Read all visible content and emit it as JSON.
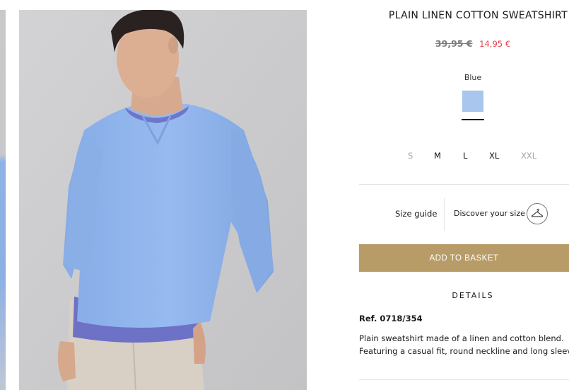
{
  "product": {
    "title": "PLAIN LINEN COTTON SWEATSHIRT",
    "price_old": "39,95 €",
    "price_new": "14,95 €",
    "color_name": "Blue",
    "swatch_color": "#a8c6ee",
    "sizes": [
      {
        "label": "S",
        "available": false
      },
      {
        "label": "M",
        "available": true
      },
      {
        "label": "L",
        "available": true
      },
      {
        "label": "XL",
        "available": true
      },
      {
        "label": "XXL",
        "available": false
      }
    ],
    "size_guide_label": "Size guide",
    "discover_label": "Discover your size",
    "discover_icon": "hanger-icon",
    "add_to_basket_label": "ADD TO BASKET",
    "details_heading": "DETAILS",
    "reference": "Ref. 0718/354",
    "description_lines": [
      "Plain sweatshirt made of a linen and cotton blend.",
      "Featuring a casual fit, round neckline and long sleev"
    ]
  },
  "colors": {
    "accent_button": "#b89c67",
    "sale_price": "#e2424b",
    "sweatshirt": "#8db4ea"
  }
}
